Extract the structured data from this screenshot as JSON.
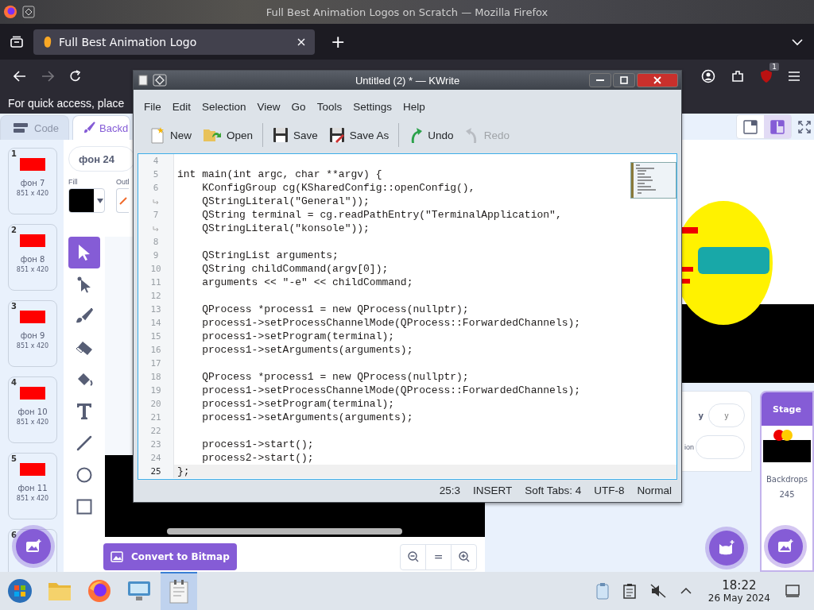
{
  "browser": {
    "title": "Full Best Animation Logos on Scratch — Mozilla Firefox",
    "tabs": [
      {
        "label": "Full Best Animation Logo",
        "selected": true
      }
    ],
    "new_tab": "+",
    "bookmarks_hint": "For quick access, place",
    "extension_badge": "1"
  },
  "scratch": {
    "editor_tabs": [
      {
        "label": "Code",
        "selected": false
      },
      {
        "label": "Backd",
        "selected": true
      }
    ],
    "backdrops": [
      {
        "number": "1",
        "name": "фон 7",
        "size": "851 x 420"
      },
      {
        "number": "2",
        "name": "фон 8",
        "size": "851 x 420"
      },
      {
        "number": "3",
        "name": "фон 9",
        "size": "851 x 420"
      },
      {
        "number": "4",
        "name": "фон 10",
        "size": "851 x 420"
      },
      {
        "number": "5",
        "name": "фон 11",
        "size": "851 x 420"
      },
      {
        "number": "6"
      }
    ],
    "costume_name": "фон 24",
    "fill_label": "Fill",
    "outline_label": "Outl",
    "tools": [
      {
        "kind": "select",
        "selected": true
      },
      {
        "kind": "reshape",
        "selected": false
      },
      {
        "kind": "brush",
        "selected": false
      },
      {
        "kind": "eraser",
        "selected": false
      },
      {
        "kind": "fill",
        "selected": false
      },
      {
        "kind": "text",
        "selected": false
      },
      {
        "kind": "line",
        "selected": false
      },
      {
        "kind": "circle",
        "selected": false
      },
      {
        "kind": "rect",
        "selected": false
      }
    ],
    "convert_button": "Convert to Bitmap",
    "zoom_reset": "=",
    "stage_views": [
      {
        "kind": "small",
        "selected": false
      },
      {
        "kind": "large",
        "selected": true
      }
    ],
    "sprite_info": {
      "y_label": "y",
      "y_placeholder": "y",
      "direction_label": "ion"
    },
    "stage_panel": {
      "title": "Stage",
      "backdrops_label": "Backdrops",
      "backdrops_count": "245"
    }
  },
  "kwrite": {
    "title": "Untitled (2) * — KWrite",
    "menu": [
      "File",
      "Edit",
      "Selection",
      "View",
      "Go",
      "Tools",
      "Settings",
      "Help"
    ],
    "toolbar": [
      [
        {
          "kind": "new",
          "label": "New",
          "disabled": false
        },
        {
          "kind": "open",
          "label": "Open",
          "disabled": false
        }
      ],
      [
        {
          "kind": "save",
          "label": "Save",
          "disabled": false
        },
        {
          "kind": "saveas",
          "label": "Save As",
          "disabled": false
        }
      ],
      [
        {
          "kind": "undo",
          "label": "Undo",
          "disabled": false
        },
        {
          "kind": "redo",
          "label": "Redo",
          "disabled": true
        }
      ]
    ],
    "lines": [
      {
        "kind": "line",
        "number": "4",
        "current": false
      },
      {
        "kind": "line",
        "number": "5",
        "text": "int main(int argc, char **argv) {",
        "current": false
      },
      {
        "kind": "line",
        "number": "6",
        "text": "    KConfigGroup cg(KSharedConfig::openConfig(),",
        "current": false
      },
      {
        "kind": "wrap",
        "text": "    QStringLiteral(\"General\"));",
        "current": false
      },
      {
        "kind": "line",
        "number": "7",
        "text": "    QString terminal = cg.readPathEntry(\"TerminalApplication\",",
        "current": false
      },
      {
        "kind": "wrap",
        "text": "    QStringLiteral(\"konsole\"));",
        "current": false
      },
      {
        "kind": "line",
        "number": "8",
        "current": false
      },
      {
        "kind": "line",
        "number": "9",
        "text": "    QStringList arguments;",
        "current": false
      },
      {
        "kind": "line",
        "number": "10",
        "text": "    QString childCommand(argv[0]);",
        "current": false
      },
      {
        "kind": "line",
        "number": "11",
        "text": "    arguments << \"-e\" << childCommand;",
        "current": false
      },
      {
        "kind": "line",
        "number": "12",
        "current": false
      },
      {
        "kind": "line",
        "number": "13",
        "text": "    QProcess *process1 = new QProcess(nullptr);",
        "current": false
      },
      {
        "kind": "line",
        "number": "14",
        "text": "    process1->setProcessChannelMode(QProcess::ForwardedChannels);",
        "current": false
      },
      {
        "kind": "line",
        "number": "15",
        "text": "    process1->setProgram(terminal);",
        "current": false
      },
      {
        "kind": "line",
        "number": "16",
        "text": "    process1->setArguments(arguments);",
        "current": false
      },
      {
        "kind": "line",
        "number": "17",
        "current": false
      },
      {
        "kind": "line",
        "number": "18",
        "text": "    QProcess *process1 = new QProcess(nullptr);",
        "current": false
      },
      {
        "kind": "line",
        "number": "19",
        "text": "    process1->setProcessChannelMode(QProcess::ForwardedChannels);",
        "current": false
      },
      {
        "kind": "line",
        "number": "20",
        "text": "    process1->setProgram(terminal);",
        "current": false
      },
      {
        "kind": "line",
        "number": "21",
        "text": "    process1->setArguments(arguments);",
        "current": false
      },
      {
        "kind": "line",
        "number": "22",
        "current": false
      },
      {
        "kind": "line",
        "number": "23",
        "text": "    process1->start();",
        "current": false
      },
      {
        "kind": "line",
        "number": "24",
        "text": "    process2->start();",
        "current": false
      },
      {
        "kind": "line",
        "number": "25",
        "text": "};",
        "current": true
      }
    ],
    "status": [
      "25:3",
      "INSERT",
      "Soft Tabs: 4",
      "UTF-8",
      "Normal"
    ]
  },
  "taskbar": {
    "apps": [
      {
        "kind": "start",
        "selected": false
      },
      {
        "kind": "files",
        "selected": false
      },
      {
        "kind": "firefox",
        "selected": false
      },
      {
        "kind": "network",
        "selected": false
      },
      {
        "kind": "kwrite",
        "selected": true
      }
    ],
    "time": "18:22",
    "date": "26 May 2024"
  }
}
